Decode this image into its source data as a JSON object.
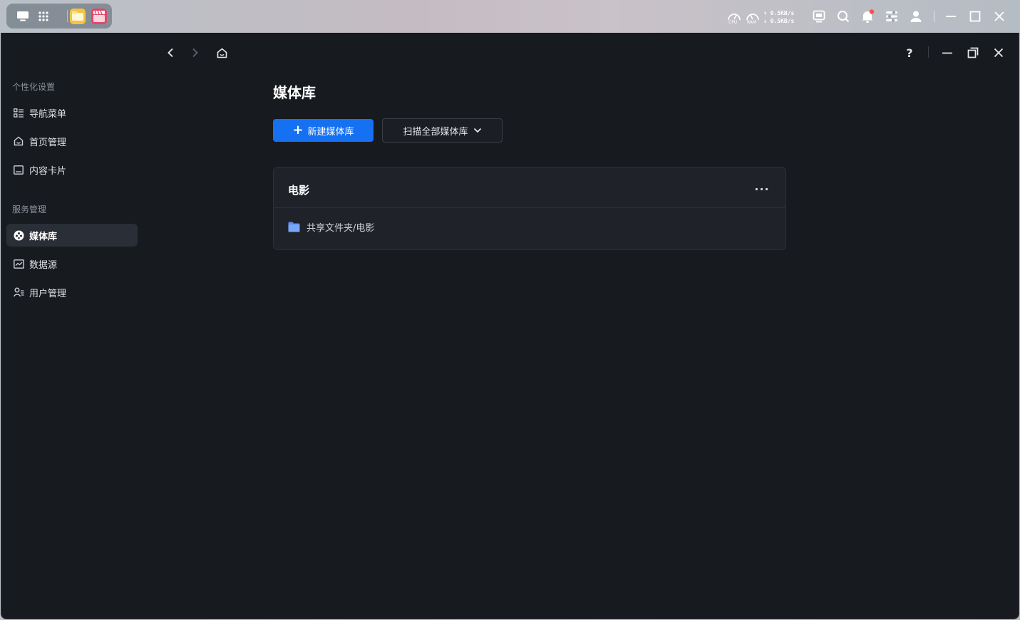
{
  "system_bar": {
    "net_up": "↑ 0.5KB/s",
    "net_down": "↓ 0.5KB/s",
    "cpu_label": "CPU",
    "ram_label": "RAM",
    "notification_dot_color": "#ff4d4f"
  },
  "sidebar": {
    "section_personalize": "个性化设置",
    "section_services": "服务管理",
    "items": [
      {
        "label": "导航菜单",
        "icon": "list-icon"
      },
      {
        "label": "首页管理",
        "icon": "home-icon"
      },
      {
        "label": "内容卡片",
        "icon": "card-icon"
      },
      {
        "label": "媒体库",
        "icon": "media-library-icon",
        "active": true
      },
      {
        "label": "数据源",
        "icon": "chart-icon"
      },
      {
        "label": "用户管理",
        "icon": "users-icon"
      }
    ]
  },
  "window": {
    "help_label": "?"
  },
  "main": {
    "title": "媒体库",
    "new_button_plus": "+",
    "new_button_label": "新建媒体库",
    "scan_button_label": "扫描全部媒体库",
    "accent_color": "#1671f2"
  },
  "library": {
    "name": "电影",
    "more_label": "···",
    "path": "共享文件夹/电影"
  }
}
